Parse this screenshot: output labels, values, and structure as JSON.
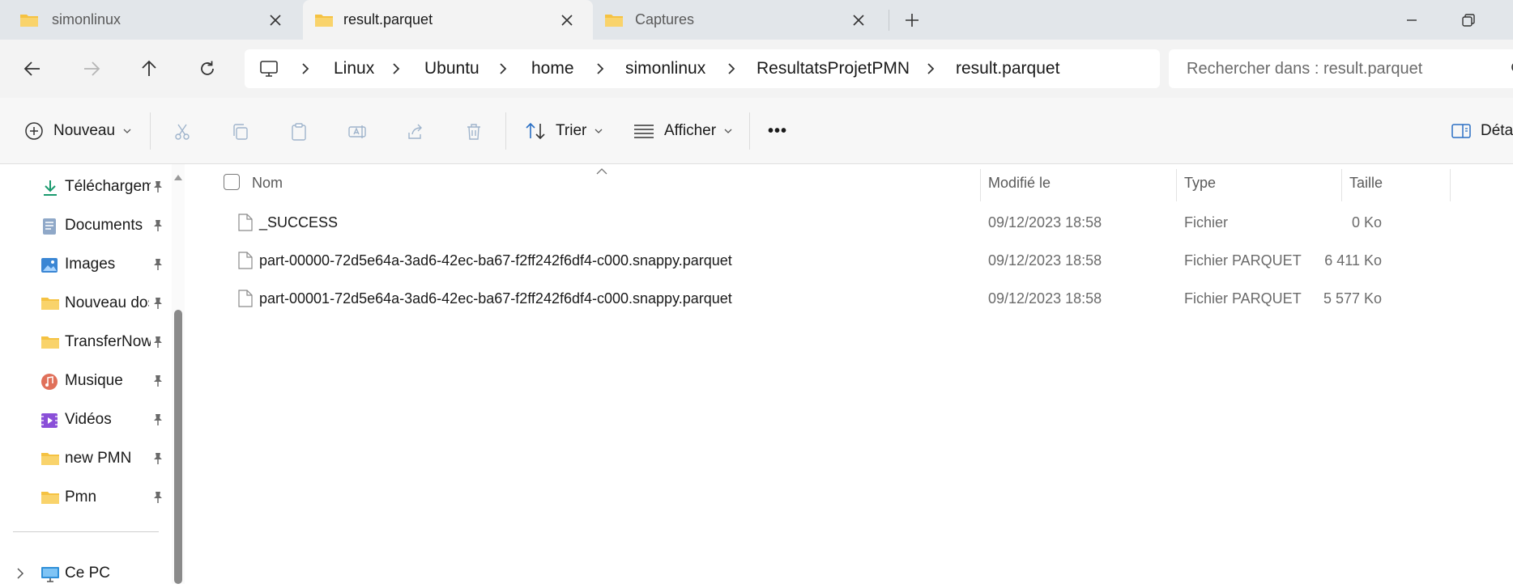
{
  "tabs": [
    {
      "label": "simonlinux",
      "active": false
    },
    {
      "label": "result.parquet",
      "active": true
    },
    {
      "label": "Captures",
      "active": false
    }
  ],
  "icons": {
    "folder": "folder-icon",
    "close": "close-icon",
    "new_tab": "plus-icon",
    "minimize": "minimize-icon",
    "restore": "restore-icon",
    "back": "arrow-left-icon",
    "forward": "arrow-right-icon",
    "up": "arrow-up-icon",
    "refresh": "refresh-icon",
    "this_pc": "monitor-icon",
    "pin": "pin-icon",
    "file": "file-icon"
  },
  "breadcrumb": [
    "Linux",
    "Ubuntu",
    "home",
    "simonlinux",
    "ResultatsProjetPMN",
    "result.parquet"
  ],
  "search": {
    "placeholder": "Rechercher dans : result.parquet"
  },
  "commands": {
    "new": "Nouveau",
    "sort": "Trier",
    "view": "Afficher",
    "more": "•••",
    "details": "Détails"
  },
  "sidebar": {
    "items": [
      {
        "label": "Téléchargements",
        "icon": "download-icon",
        "pinned": true
      },
      {
        "label": "Documents",
        "icon": "documents-icon",
        "pinned": true
      },
      {
        "label": "Images",
        "icon": "images-icon",
        "pinned": true
      },
      {
        "label": "Nouveau dossier",
        "icon": "folder-icon",
        "pinned": true
      },
      {
        "label": "TransferNow-",
        "icon": "folder-icon",
        "pinned": true
      },
      {
        "label": "Musique",
        "icon": "music-icon",
        "pinned": true
      },
      {
        "label": "Vidéos",
        "icon": "videos-icon",
        "pinned": true
      },
      {
        "label": "new PMN",
        "icon": "folder-icon",
        "pinned": true
      },
      {
        "label": "Pmn",
        "icon": "folder-icon",
        "pinned": true
      }
    ],
    "this_pc": "Ce PC"
  },
  "columns": {
    "name": "Nom",
    "modified": "Modifié le",
    "type": "Type",
    "size": "Taille"
  },
  "files": [
    {
      "name": "_SUCCESS",
      "modified": "09/12/2023 18:58",
      "type": "Fichier",
      "size": "0 Ko"
    },
    {
      "name": "part-00000-72d5e64a-3ad6-42ec-ba67-f2ff242f6df4-c000.snappy.parquet",
      "modified": "09/12/2023 18:58",
      "type": "Fichier PARQUET",
      "size": "6 411 Ko"
    },
    {
      "name": "part-00001-72d5e64a-3ad6-42ec-ba67-f2ff242f6df4-c000.snappy.parquet",
      "modified": "09/12/2023 18:58",
      "type": "Fichier PARQUET",
      "size": "5 577 Ko"
    }
  ],
  "colors": {
    "folder": "#f5c242",
    "tab_bar": "#e2e6ea",
    "accent": "#2a6fc4"
  }
}
